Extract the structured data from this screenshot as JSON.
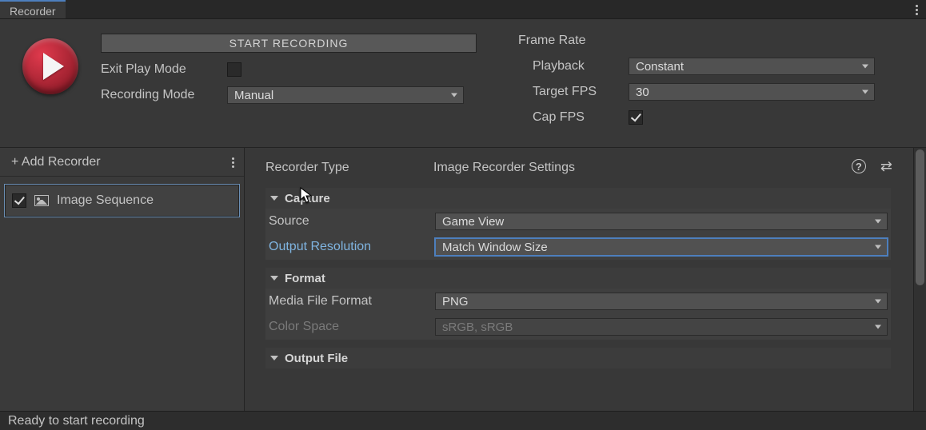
{
  "tab": {
    "title": "Recorder"
  },
  "actions": {
    "start_label": "START RECORDING",
    "add_recorder_label": "+ Add Recorder"
  },
  "controls": {
    "exit_play_mode_label": "Exit Play Mode",
    "exit_play_mode_checked": false,
    "recording_mode_label": "Recording Mode",
    "recording_mode_value": "Manual"
  },
  "frame_rate": {
    "header": "Frame Rate",
    "playback_label": "Playback",
    "playback_value": "Constant",
    "target_fps_label": "Target FPS",
    "target_fps_value": "30",
    "cap_fps_label": "Cap FPS",
    "cap_fps_checked": true
  },
  "recorder_list": {
    "items": [
      {
        "enabled": true,
        "label": "Image Sequence"
      }
    ]
  },
  "details": {
    "recorder_type_label": "Recorder Type",
    "recorder_type_value": "Image Recorder Settings",
    "sections": {
      "capture": {
        "title": "Capture",
        "source_label": "Source",
        "source_value": "Game View",
        "output_res_label": "Output Resolution",
        "output_res_value": "Match Window Size"
      },
      "format": {
        "title": "Format",
        "media_format_label": "Media File Format",
        "media_format_value": "PNG",
        "color_space_label": "Color Space",
        "color_space_value": "sRGB, sRGB"
      },
      "output_file": {
        "title": "Output File"
      }
    }
  },
  "status_text": "Ready to start recording"
}
